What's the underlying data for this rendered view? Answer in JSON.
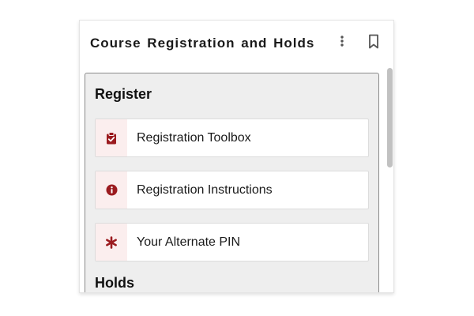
{
  "card": {
    "title": "Course Registration and Holds",
    "menu_icon": "vertical-ellipsis-icon",
    "bookmark_icon": "bookmark-icon"
  },
  "register": {
    "title": "Register",
    "items": [
      {
        "label": "Registration Toolbox",
        "icon": "clipboard-check-icon"
      },
      {
        "label": "Registration Instructions",
        "icon": "info-circle-icon"
      },
      {
        "label": "Your Alternate PIN",
        "icon": "asterisk-icon"
      }
    ]
  },
  "holds": {
    "title": "Holds"
  },
  "colors": {
    "accent": "#9b1b1f",
    "icon_background": "#fbeeee",
    "panel_background": "#eeeeee"
  }
}
